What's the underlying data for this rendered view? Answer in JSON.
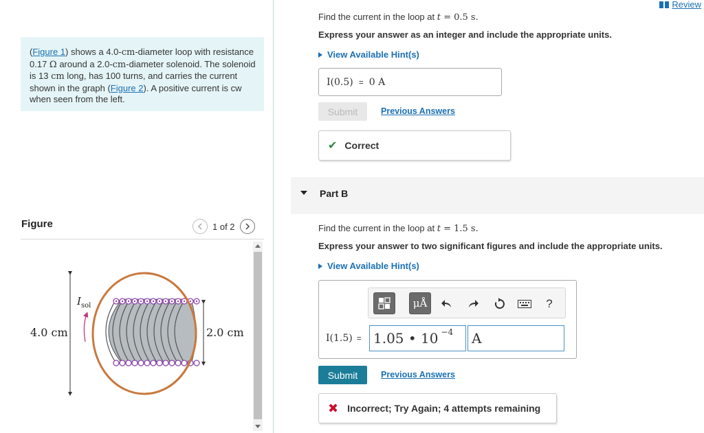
{
  "header": {
    "review_label": "Review"
  },
  "problem": {
    "figure1_link": "Figure 1",
    "text_a": " shows a 4.0-",
    "unit_cm": "cm",
    "text_b": "-diameter loop with resistance 0.17 ",
    "unit_ohm": "Ω",
    "text_c": " around a 2.0-",
    "text_d": "-diameter solenoid. The solenoid is 13 ",
    "text_e": " long, has 100 turns, and carries the current shown in the graph (",
    "figure2_link": "Figure 2",
    "text_f": "). A positive current is cw when seen from the left."
  },
  "figure": {
    "label": "Figure",
    "counter": "1 of 2",
    "loop_diameter": "4.0 cm",
    "solenoid_diameter": "2.0 cm",
    "current_label_main": "I",
    "current_label_sub": "sol"
  },
  "partA": {
    "question_prefix": "Find the current in the loop at ",
    "question_var": "t",
    "question_value": " = 0.5 s.",
    "instruction": "Express your answer as an integer and include the appropriate units.",
    "hint_label": "View Available Hint(s)",
    "answer_label": "I(0.5)",
    "answer_eq": "=",
    "answer_value": "0 A",
    "submit_label": "Submit",
    "previous_label": "Previous Answers",
    "feedback": "Correct"
  },
  "partB": {
    "title": "Part B",
    "question_prefix": "Find the current in the loop at ",
    "question_var": "t",
    "question_value": " = 1.5 s.",
    "instruction": "Express your answer to two significant figures and include the appropriate units.",
    "hint_label": "View Available Hint(s)",
    "answer_label": "I(1.5)",
    "answer_eq": "=",
    "value_mantissa": "1.05 • 10",
    "value_exponent": "−4",
    "unit_value": "A",
    "toolbar_units": "μÅ",
    "toolbar_help": "?",
    "submit_label": "Submit",
    "previous_label": "Previous Answers",
    "feedback": "Incorrect; Try Again; 4 attempts remaining"
  },
  "colors": {
    "link": "#1a70b4",
    "problem_bg": "#e5f5f7",
    "submit_active": "#1b7d98",
    "correct": "#2e8540",
    "incorrect": "#c8102e",
    "loop": "#c8793f",
    "coil": "#8e44ad"
  }
}
